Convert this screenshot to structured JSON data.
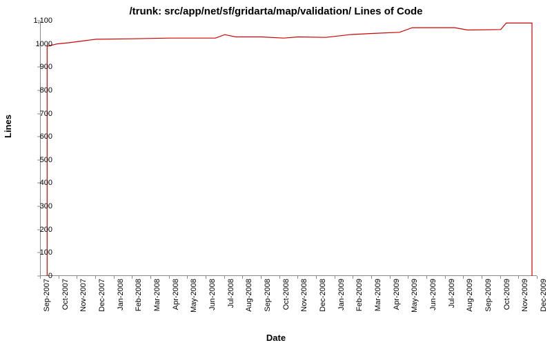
{
  "chart_data": {
    "type": "line",
    "title": "/trunk: src/app/net/sf/gridarta/map/validation/ Lines of Code",
    "xlabel": "Date",
    "ylabel": "Lines",
    "ylim": [
      0,
      1100
    ],
    "y_ticks": [
      0,
      100,
      200,
      300,
      400,
      500,
      600,
      700,
      800,
      900,
      1000,
      "1,100"
    ],
    "x_ticks": [
      "Sep-2007",
      "Oct-2007",
      "Nov-2007",
      "Dec-2007",
      "Jan-2008",
      "Feb-2008",
      "Mar-2008",
      "Apr-2008",
      "May-2008",
      "Jun-2008",
      "Jul-2008",
      "Aug-2008",
      "Sep-2008",
      "Oct-2008",
      "Nov-2008",
      "Dec-2008",
      "Jan-2009",
      "Feb-2009",
      "Mar-2009",
      "Apr-2009",
      "May-2009",
      "Jun-2009",
      "Jul-2009",
      "Aug-2009",
      "Sep-2009",
      "Oct-2009",
      "Nov-2009",
      "Dec-2009"
    ],
    "series": [
      {
        "name": "Lines of Code",
        "color": "#cc0000",
        "points": [
          {
            "x": 0.35,
            "y": 0
          },
          {
            "x": 0.35,
            "y": 990
          },
          {
            "x": 0.9,
            "y": 1000
          },
          {
            "x": 1.5,
            "y": 1005
          },
          {
            "x": 2.5,
            "y": 1015
          },
          {
            "x": 3.0,
            "y": 1020
          },
          {
            "x": 5.0,
            "y": 1022
          },
          {
            "x": 7.0,
            "y": 1025
          },
          {
            "x": 9.5,
            "y": 1025
          },
          {
            "x": 10.0,
            "y": 1040
          },
          {
            "x": 10.6,
            "y": 1030
          },
          {
            "x": 12.0,
            "y": 1030
          },
          {
            "x": 13.2,
            "y": 1025
          },
          {
            "x": 14.0,
            "y": 1030
          },
          {
            "x": 15.5,
            "y": 1028
          },
          {
            "x": 16.8,
            "y": 1040
          },
          {
            "x": 18.0,
            "y": 1045
          },
          {
            "x": 19.5,
            "y": 1050
          },
          {
            "x": 20.2,
            "y": 1070
          },
          {
            "x": 22.5,
            "y": 1070
          },
          {
            "x": 23.2,
            "y": 1060
          },
          {
            "x": 25.0,
            "y": 1062
          },
          {
            "x": 25.3,
            "y": 1090
          },
          {
            "x": 26.7,
            "y": 1090
          },
          {
            "x": 26.7,
            "y": 0
          }
        ]
      }
    ]
  }
}
